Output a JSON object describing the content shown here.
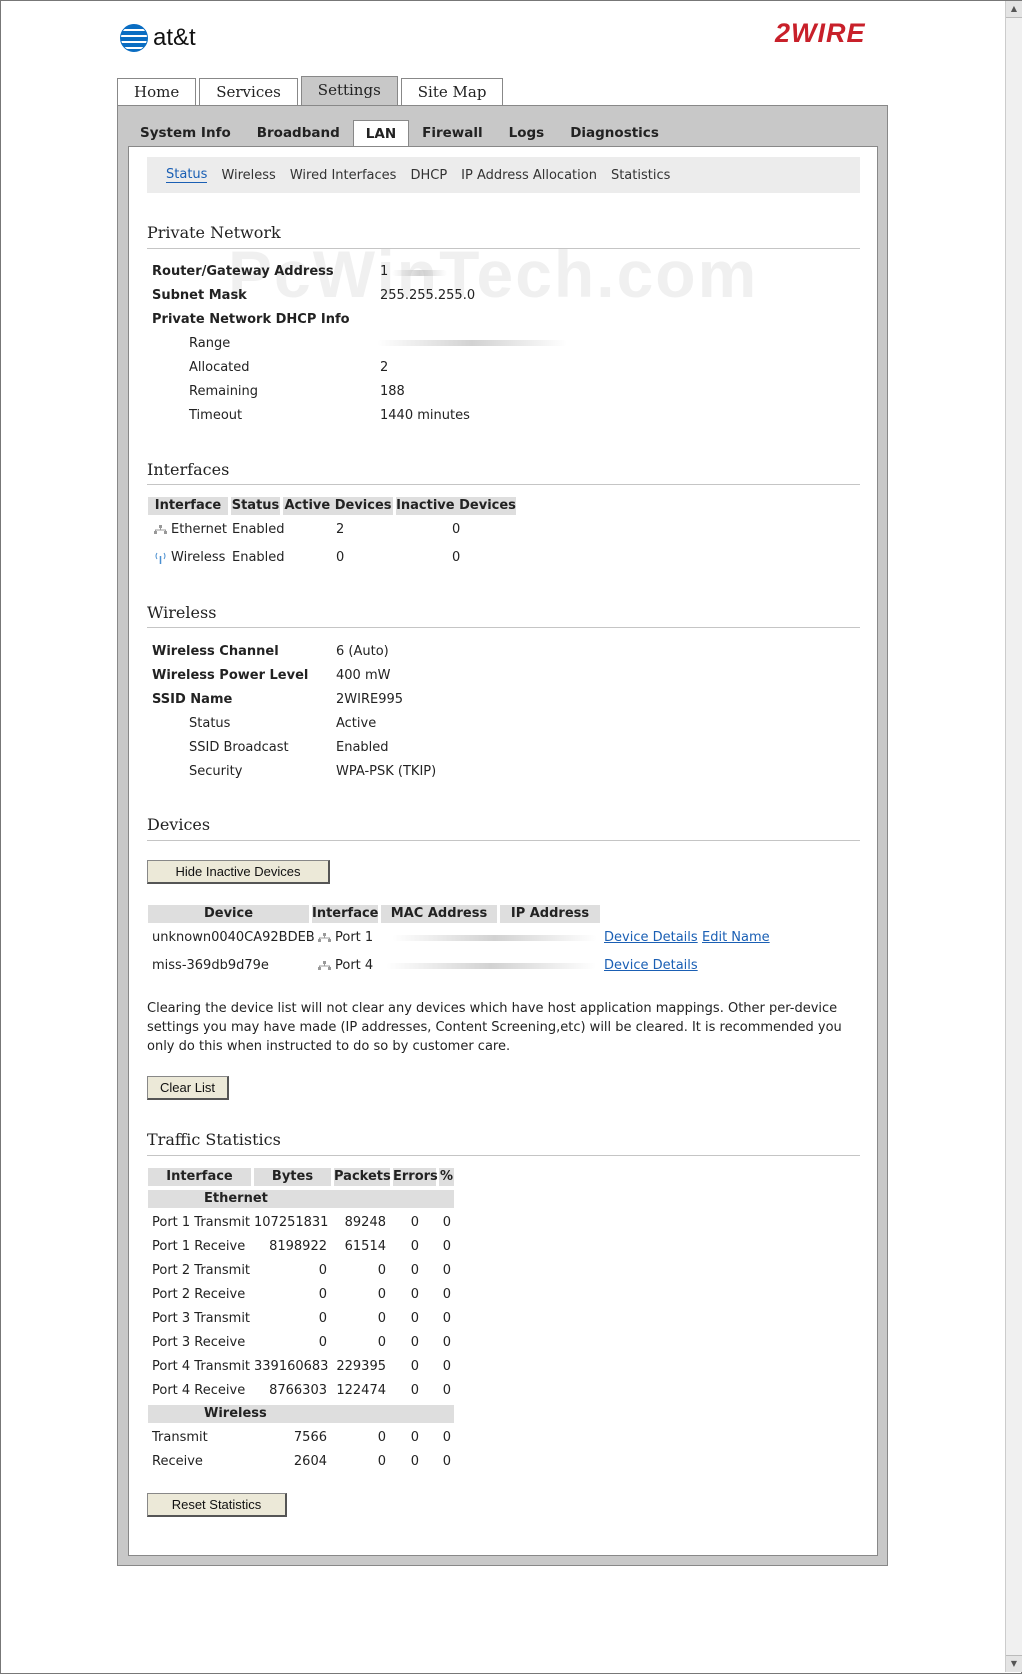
{
  "brand": {
    "att": "at&t",
    "twowire": "2WIRE"
  },
  "top_tabs": [
    "Home",
    "Services",
    "Settings",
    "Site Map"
  ],
  "sub_tabs": [
    "System Info",
    "Broadband",
    "LAN",
    "Firewall",
    "Logs",
    "Diagnostics"
  ],
  "subnav": [
    "Status",
    "Wireless",
    "Wired Interfaces",
    "DHCP",
    "IP Address Allocation",
    "Statistics"
  ],
  "watermark": "PcWinTech.com",
  "private_network": {
    "title": "Private Network",
    "router_label": "Router/Gateway Address",
    "router_value": "1",
    "subnet_label": "Subnet Mask",
    "subnet_value": "255.255.255.0",
    "dhcp_label": "Private Network DHCP Info",
    "range_label": "Range",
    "allocated_label": "Allocated",
    "allocated_value": "2",
    "remaining_label": "Remaining",
    "remaining_value": "188",
    "timeout_label": "Timeout",
    "timeout_value": "1440 minutes"
  },
  "interfaces": {
    "title": "Interfaces",
    "headers": [
      "Interface",
      "Status",
      "Active Devices",
      "Inactive Devices"
    ],
    "rows": [
      {
        "name": "Ethernet",
        "status": "Enabled",
        "active": "2",
        "inactive": "0"
      },
      {
        "name": "Wireless",
        "status": "Enabled",
        "active": "0",
        "inactive": "0"
      }
    ]
  },
  "wireless": {
    "title": "Wireless",
    "channel_label": "Wireless Channel",
    "channel_value": "6 (Auto)",
    "power_label": "Wireless Power Level",
    "power_value": "400 mW",
    "ssid_label": "SSID Name",
    "ssid_value": "2WIRE995",
    "status_label": "Status",
    "status_value": "Active",
    "broadcast_label": "SSID Broadcast",
    "broadcast_value": "Enabled",
    "security_label": "Security",
    "security_value": "WPA-PSK (TKIP)"
  },
  "devices": {
    "title": "Devices",
    "hide_button": "Hide Inactive Devices",
    "headers": [
      "Device",
      "Interface",
      "MAC Address",
      "IP Address"
    ],
    "rows": [
      {
        "name": "unknown0040CA92BDEB",
        "iface": "Port 1",
        "details": "Device Details",
        "edit": "Edit Name"
      },
      {
        "name": "miss-369db9d79e",
        "iface": "Port 4",
        "details": "Device Details"
      }
    ],
    "note": "Clearing the device list will not clear any devices which have host application mappings. Other per-device settings you may have made (IP addresses, Content Screening,etc) will be cleared. It is recommended you only do this when instructed to do so by customer care.",
    "clear_button": "Clear List"
  },
  "traffic": {
    "title": "Traffic Statistics",
    "headers": [
      "Interface",
      "Bytes",
      "Packets",
      "Errors",
      "%"
    ],
    "ethernet_group": "Ethernet",
    "wireless_group": "Wireless",
    "ethernet_rows": [
      {
        "name": "Port 1 Transmit",
        "bytes": "107251831",
        "packets": "89248",
        "errors": "0",
        "pct": "0"
      },
      {
        "name": "Port 1 Receive",
        "bytes": "8198922",
        "packets": "61514",
        "errors": "0",
        "pct": "0"
      },
      {
        "name": "Port 2 Transmit",
        "bytes": "0",
        "packets": "0",
        "errors": "0",
        "pct": "0"
      },
      {
        "name": "Port 2 Receive",
        "bytes": "0",
        "packets": "0",
        "errors": "0",
        "pct": "0"
      },
      {
        "name": "Port 3 Transmit",
        "bytes": "0",
        "packets": "0",
        "errors": "0",
        "pct": "0"
      },
      {
        "name": "Port 3 Receive",
        "bytes": "0",
        "packets": "0",
        "errors": "0",
        "pct": "0"
      },
      {
        "name": "Port 4 Transmit",
        "bytes": "339160683",
        "packets": "229395",
        "errors": "0",
        "pct": "0"
      },
      {
        "name": "Port 4 Receive",
        "bytes": "8766303",
        "packets": "122474",
        "errors": "0",
        "pct": "0"
      }
    ],
    "wireless_rows": [
      {
        "name": "Transmit",
        "bytes": "7566",
        "packets": "0",
        "errors": "0",
        "pct": "0"
      },
      {
        "name": "Receive",
        "bytes": "2604",
        "packets": "0",
        "errors": "0",
        "pct": "0"
      }
    ],
    "reset_button": "Reset Statistics"
  },
  "colors": {
    "link": "#1a5fb4",
    "brand_red": "#c8202a",
    "att_blue": "#0a6dc2"
  },
  "icons": {
    "ethernet": "ethernet-icon",
    "wireless": "wireless-antenna-icon"
  }
}
